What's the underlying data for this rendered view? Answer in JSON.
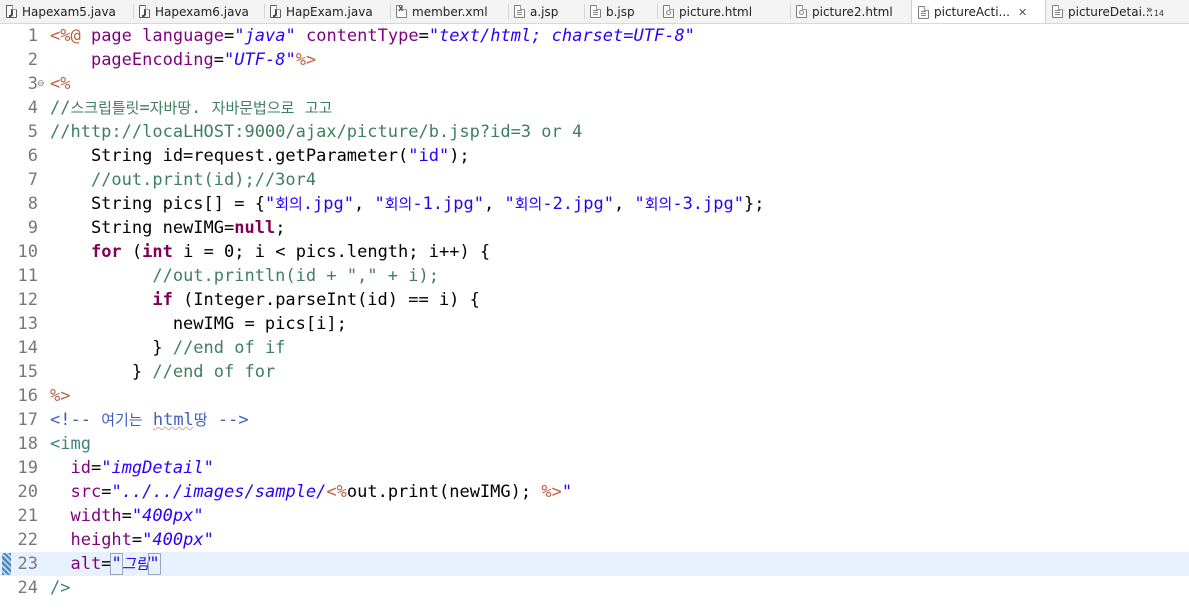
{
  "tabs": [
    {
      "label": "Hapexam5.java",
      "icon": "java-file-icon"
    },
    {
      "label": "Hapexam6.java",
      "icon": "java-file-icon"
    },
    {
      "label": "HapExam.java",
      "icon": "java-file-icon"
    },
    {
      "label": "member.xml",
      "icon": "xml-file-icon"
    },
    {
      "label": "a.jsp",
      "icon": "jsp-file-icon"
    },
    {
      "label": "b.jsp",
      "icon": "jsp-file-icon"
    },
    {
      "label": "picture.html",
      "icon": "html-file-icon"
    },
    {
      "label": "picture2.html",
      "icon": "html-file-icon"
    },
    {
      "label": "pictureActi...",
      "icon": "jsp-file-icon",
      "active": true,
      "close": "✕"
    },
    {
      "label": "pictureDetai...",
      "icon": "jsp-file-icon"
    }
  ],
  "overflow": {
    "chevron": "»",
    "count": "14"
  },
  "colors": {
    "jsp_delimiter": "#bf5f3f",
    "attribute": "#7f007f",
    "string": "#2a00ff",
    "comment": "#3f7f5f",
    "keyword": "#7f0055",
    "tag": "#3f7f7f",
    "html_comment": "#3f5fbf",
    "line_number": "#787878",
    "current_line": "#e8f2fe"
  },
  "editor": {
    "current_line": 23,
    "lines": [
      {
        "n": "1",
        "tokens": [
          {
            "t": "<%@ ",
            "c": "dl"
          },
          {
            "t": "page",
            "c": "attr"
          },
          {
            "t": " ",
            "c": "plain"
          },
          {
            "t": "language",
            "c": "attr"
          },
          {
            "t": "=",
            "c": "plain"
          },
          {
            "t": "\"java\"",
            "c": "str"
          },
          {
            "t": " ",
            "c": "plain"
          },
          {
            "t": "contentType",
            "c": "attr"
          },
          {
            "t": "=",
            "c": "plain"
          },
          {
            "t": "\"text/html; charset=UTF-8\"",
            "c": "str"
          }
        ]
      },
      {
        "n": "2",
        "tokens": [
          {
            "t": "    ",
            "c": "plain"
          },
          {
            "t": "pageEncoding",
            "c": "attr"
          },
          {
            "t": "=",
            "c": "plain"
          },
          {
            "t": "\"UTF-8\"",
            "c": "str"
          },
          {
            "t": "%>",
            "c": "dl"
          }
        ]
      },
      {
        "n": "3",
        "fold": "⊖",
        "tokens": [
          {
            "t": "<%",
            "c": "dl"
          }
        ]
      },
      {
        "n": "4",
        "tokens": [
          {
            "t": "//스크립틀릿=자바땅. 자바문법으로 고고",
            "c": "com"
          }
        ]
      },
      {
        "n": "5",
        "tokens": [
          {
            "t": "//http://locaLHOST:9000/ajax/picture/b.jsp?id=3 or 4",
            "c": "com"
          }
        ]
      },
      {
        "n": "6",
        "tokens": [
          {
            "t": "    String id=request.getParameter(",
            "c": "plain"
          },
          {
            "t": "\"id\"",
            "c": "jstr"
          },
          {
            "t": ");",
            "c": "plain"
          }
        ]
      },
      {
        "n": "7",
        "tokens": [
          {
            "t": "    ",
            "c": "plain"
          },
          {
            "t": "//out.print(id);//3or4",
            "c": "com"
          }
        ]
      },
      {
        "n": "8",
        "tokens": [
          {
            "t": "    String pics[] = {",
            "c": "plain"
          },
          {
            "t": "\"회의.jpg\"",
            "c": "jstr"
          },
          {
            "t": ", ",
            "c": "plain"
          },
          {
            "t": "\"회의-1.jpg\"",
            "c": "jstr"
          },
          {
            "t": ", ",
            "c": "plain"
          },
          {
            "t": "\"회의-2.jpg\"",
            "c": "jstr"
          },
          {
            "t": ", ",
            "c": "plain"
          },
          {
            "t": "\"회의-3.jpg\"",
            "c": "jstr"
          },
          {
            "t": "};",
            "c": "plain"
          }
        ]
      },
      {
        "n": "9",
        "tokens": [
          {
            "t": "    String newIMG=",
            "c": "plain"
          },
          {
            "t": "null",
            "c": "kw"
          },
          {
            "t": ";",
            "c": "plain"
          }
        ]
      },
      {
        "n": "10",
        "tokens": [
          {
            "t": "    ",
            "c": "plain"
          },
          {
            "t": "for",
            "c": "kw"
          },
          {
            "t": " (",
            "c": "plain"
          },
          {
            "t": "int",
            "c": "kw"
          },
          {
            "t": " i = 0; i < pics.length; i++) {",
            "c": "plain"
          }
        ]
      },
      {
        "n": "11",
        "tokens": [
          {
            "t": "          ",
            "c": "plain"
          },
          {
            "t": "//out.println(id + \",\" + i);",
            "c": "com"
          }
        ]
      },
      {
        "n": "12",
        "tokens": [
          {
            "t": "          ",
            "c": "plain"
          },
          {
            "t": "if",
            "c": "kw"
          },
          {
            "t": " (Integer.parseInt(id) == i) {",
            "c": "plain"
          }
        ]
      },
      {
        "n": "13",
        "tokens": [
          {
            "t": "            newIMG = pics[i];",
            "c": "plain"
          }
        ]
      },
      {
        "n": "14",
        "tokens": [
          {
            "t": "          } ",
            "c": "plain"
          },
          {
            "t": "//end of if",
            "c": "com"
          }
        ]
      },
      {
        "n": "15",
        "tokens": [
          {
            "t": "        } ",
            "c": "plain"
          },
          {
            "t": "//end of for",
            "c": "com"
          }
        ]
      },
      {
        "n": "16",
        "tokens": [
          {
            "t": "%>",
            "c": "dl"
          }
        ]
      },
      {
        "n": "17",
        "tokens": [
          {
            "t": "<!-- 여기는 ",
            "c": "hcom"
          },
          {
            "t": "html",
            "c": "hcom",
            "spell": true
          },
          {
            "t": "땅 -->",
            "c": "hcom"
          }
        ]
      },
      {
        "n": "18",
        "tokens": [
          {
            "t": "<img",
            "c": "tag"
          }
        ]
      },
      {
        "n": "19",
        "tokens": [
          {
            "t": "  ",
            "c": "plain"
          },
          {
            "t": "id",
            "c": "attr"
          },
          {
            "t": "=",
            "c": "plain"
          },
          {
            "t": "\"imgDetail\"",
            "c": "str"
          }
        ]
      },
      {
        "n": "20",
        "tokens": [
          {
            "t": "  ",
            "c": "plain"
          },
          {
            "t": "src",
            "c": "attr"
          },
          {
            "t": "=",
            "c": "plain"
          },
          {
            "t": "\"../../images/sample/",
            "c": "str"
          },
          {
            "t": "<%",
            "c": "dl"
          },
          {
            "t": "out.print(newIMG); ",
            "c": "plain"
          },
          {
            "t": "%>",
            "c": "dl"
          },
          {
            "t": "\"",
            "c": "str"
          }
        ]
      },
      {
        "n": "21",
        "tokens": [
          {
            "t": "  ",
            "c": "plain"
          },
          {
            "t": "width",
            "c": "attr"
          },
          {
            "t": "=",
            "c": "plain"
          },
          {
            "t": "\"400px\"",
            "c": "str"
          }
        ]
      },
      {
        "n": "22",
        "tokens": [
          {
            "t": "  ",
            "c": "plain"
          },
          {
            "t": "height",
            "c": "attr"
          },
          {
            "t": "=",
            "c": "plain"
          },
          {
            "t": "\"400px\"",
            "c": "str"
          }
        ]
      },
      {
        "n": "23",
        "caret": true,
        "tokens": [
          {
            "t": "  ",
            "c": "plain"
          },
          {
            "t": "alt",
            "c": "attr"
          },
          {
            "t": "=",
            "c": "plain"
          },
          {
            "t": "\"",
            "c": "str",
            "box": true
          },
          {
            "t": "그림",
            "c": "str"
          },
          {
            "t": "\"",
            "c": "str",
            "box": true
          }
        ]
      },
      {
        "n": "24",
        "tokens": [
          {
            "t": "/>",
            "c": "tag"
          }
        ]
      }
    ]
  }
}
